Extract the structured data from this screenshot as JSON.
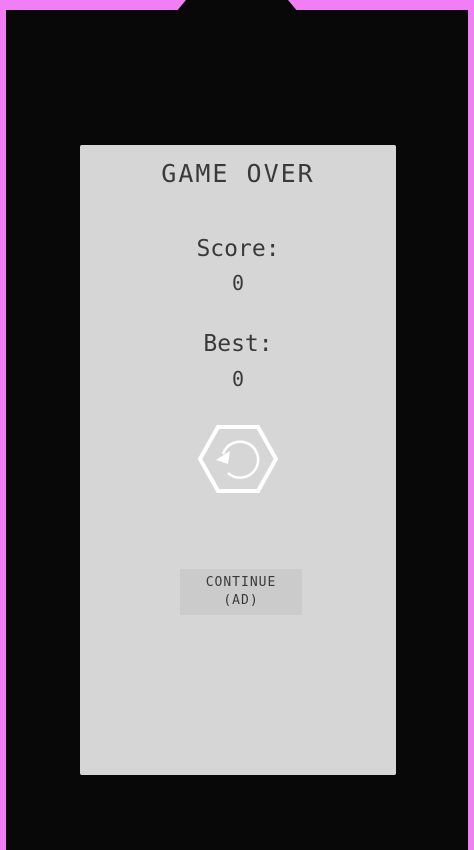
{
  "colors": {
    "border": "#f27ef5",
    "background": "#080808",
    "panel": "#d6d6d6",
    "button": "#cbcbcb",
    "text": "#3a3a3a",
    "icon": "#ffffff"
  },
  "panel": {
    "title": "GAME OVER",
    "score_label": "Score:",
    "score_value": "0",
    "best_label": "Best:",
    "best_value": "0"
  },
  "restart_button": {
    "icon": "restart-hexagon-icon"
  },
  "continue_button": {
    "line1": "CONTINUE",
    "line2": "(AD)"
  }
}
